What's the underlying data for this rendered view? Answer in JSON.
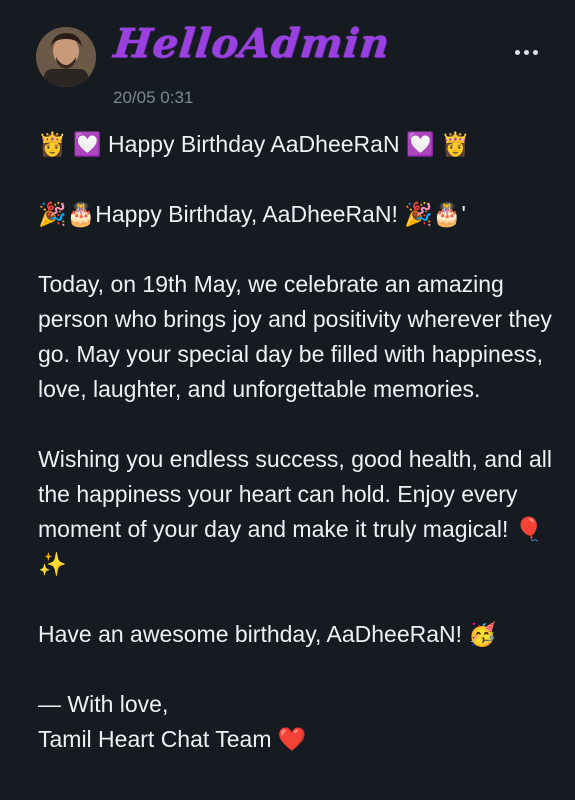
{
  "post": {
    "author": "HelloAdmin",
    "timestamp": "20/05 0:31",
    "menu_icon": "more-options-icon"
  },
  "message": {
    "line_title": "👸 💟 Happy Birthday AaDheeRaN 💟 👸",
    "line_greeting": "🎉🎂Happy Birthday, AaDheeRaN! 🎉🎂'",
    "para_1": "Today, on 19th May, we celebrate an amazing person who brings joy and positivity wherever they go. May your special day be filled with happiness, love, laughter, and unforgettable memories.",
    "para_2": "Wishing you endless success, good health, and all the happiness your heart can hold. Enjoy every moment of your day and make it truly magical! 🎈✨",
    "line_closing": "Have an awesome birthday, AaDheeRaN! 🥳",
    "sign_1": "— With love,",
    "sign_2": "Tamil Heart Chat Team ❤️"
  },
  "colors": {
    "background": "#161b21",
    "author_name": "#9a3fe0",
    "timestamp": "#7c8691"
  }
}
